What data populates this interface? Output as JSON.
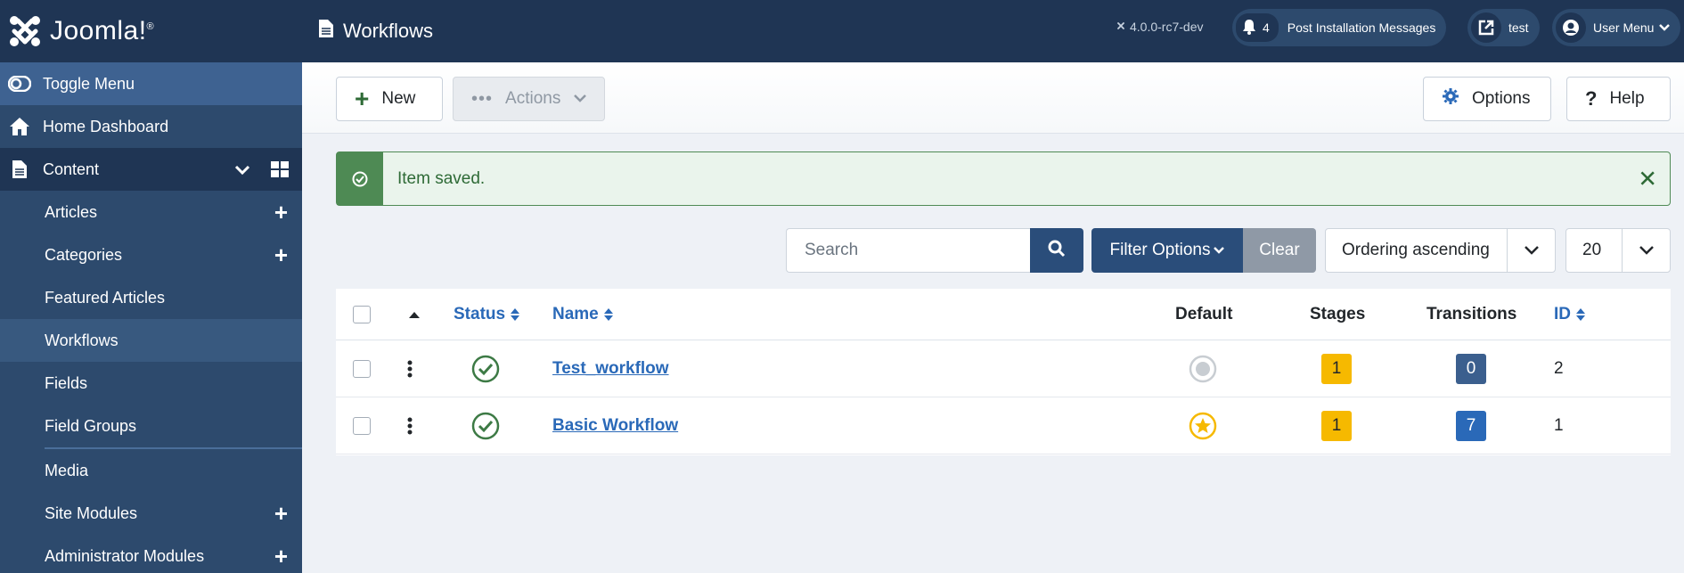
{
  "brand": {
    "name": "Joomla!",
    "mark": "®"
  },
  "sidebar": {
    "toggle_label": "Toggle Menu",
    "home_label": "Home Dashboard",
    "content_label": "Content",
    "items": [
      {
        "label": "Articles",
        "has_add": true
      },
      {
        "label": "Categories",
        "has_add": true
      },
      {
        "label": "Featured Articles",
        "has_add": false
      },
      {
        "label": "Workflows",
        "has_add": false,
        "active": true
      },
      {
        "label": "Fields",
        "has_add": false
      },
      {
        "label": "Field Groups",
        "has_add": false
      },
      {
        "label": "Media",
        "has_add": false
      },
      {
        "label": "Site Modules",
        "has_add": true
      },
      {
        "label": "Administrator Modules",
        "has_add": true
      }
    ]
  },
  "header": {
    "title": "Workflows",
    "version": "4.0.0-rc7-dev",
    "notifications_count": "4",
    "notifications_label": "Post Installation Messages",
    "site_label": "test",
    "user_menu_label": "User Menu"
  },
  "toolbar": {
    "new_label": "New",
    "actions_label": "Actions",
    "options_label": "Options",
    "help_label": "Help"
  },
  "alert": {
    "message": "Item saved.",
    "close_symbol": "✕"
  },
  "filters": {
    "search_placeholder": "Search",
    "filter_options_label": "Filter Options",
    "clear_label": "Clear",
    "ordering_value": "Ordering ascending",
    "limit_value": "20"
  },
  "table": {
    "headers": {
      "status": "Status",
      "name": "Name",
      "default": "Default",
      "stages": "Stages",
      "transitions": "Transitions",
      "id": "ID"
    },
    "rows": [
      {
        "name": "Test_workflow",
        "default": false,
        "stages": "1",
        "transitions": "0",
        "id": "2"
      },
      {
        "name": "Basic Workflow",
        "default": true,
        "stages": "1",
        "transitions": "7",
        "id": "1"
      }
    ]
  },
  "colors": {
    "sidebar_bg": "#2d4a6d",
    "header_bg": "#1f3554",
    "primary": "#2a4d7a",
    "success": "#4e8a54",
    "link": "#2a69b8",
    "warning_badge": "#f6b900"
  }
}
